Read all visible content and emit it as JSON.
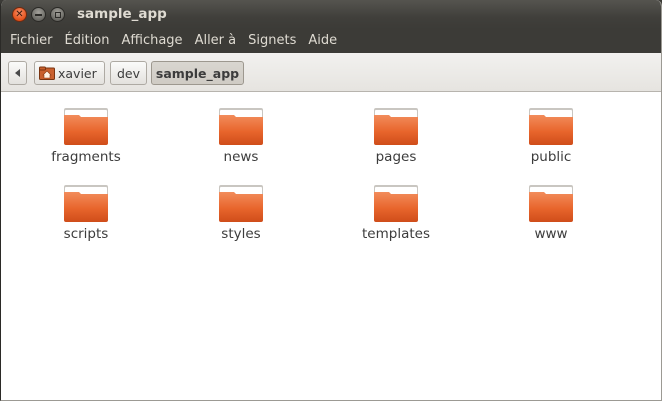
{
  "window": {
    "title": "sample_app"
  },
  "menu": [
    "Fichier",
    "Édition",
    "Affichage",
    "Aller à",
    "Signets",
    "Aide"
  ],
  "pathbar": {
    "items": [
      "xavier",
      "dev",
      "sample_app"
    ],
    "current": "sample_app"
  },
  "folders": [
    {
      "name": "fragments"
    },
    {
      "name": "news"
    },
    {
      "name": "pages"
    },
    {
      "name": "public"
    },
    {
      "name": "scripts"
    },
    {
      "name": "styles"
    },
    {
      "name": "templates"
    },
    {
      "name": "www"
    }
  ],
  "colors": {
    "folder_body": "#e8652c",
    "folder_light": "#f08a5a",
    "titlebar": "#3c3b37",
    "close_button": "#e5521b"
  },
  "icons": {
    "back": "chevron-left-icon",
    "home": "home-folder-icon",
    "folder": "folder-icon"
  }
}
